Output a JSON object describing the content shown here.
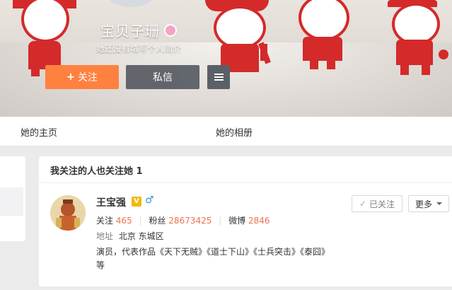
{
  "profile": {
    "name": "宝贝子珊",
    "bio": "她还没有填写个人简介",
    "follow_label": "关注",
    "follow_icon": "plus-icon",
    "message_label": "私信",
    "menu_icon": "menu-icon"
  },
  "tabs": [
    {
      "label": "她的主页"
    },
    {
      "label": "她的相册"
    }
  ],
  "mutual": {
    "title": "我关注的人也关注她 1",
    "user": {
      "name": "王宝强",
      "verified_icon": "verified-v-icon",
      "gender_icon": "male-icon",
      "follow_label": "关注",
      "follow_count": "465",
      "fans_label": "粉丝",
      "fans_count": "28673425",
      "weibo_label": "微博",
      "weibo_count": "2846",
      "address_label": "地址",
      "address": "北京 东城区",
      "description": "演员，代表作品《天下无贼》《道士下山》《士兵突击》《泰囧》等",
      "followed_label": "已关注",
      "more_label": "更多"
    }
  },
  "colors": {
    "accent": "#ff8140",
    "number": "#eb7350",
    "papercut_red": "#d42a2a"
  }
}
